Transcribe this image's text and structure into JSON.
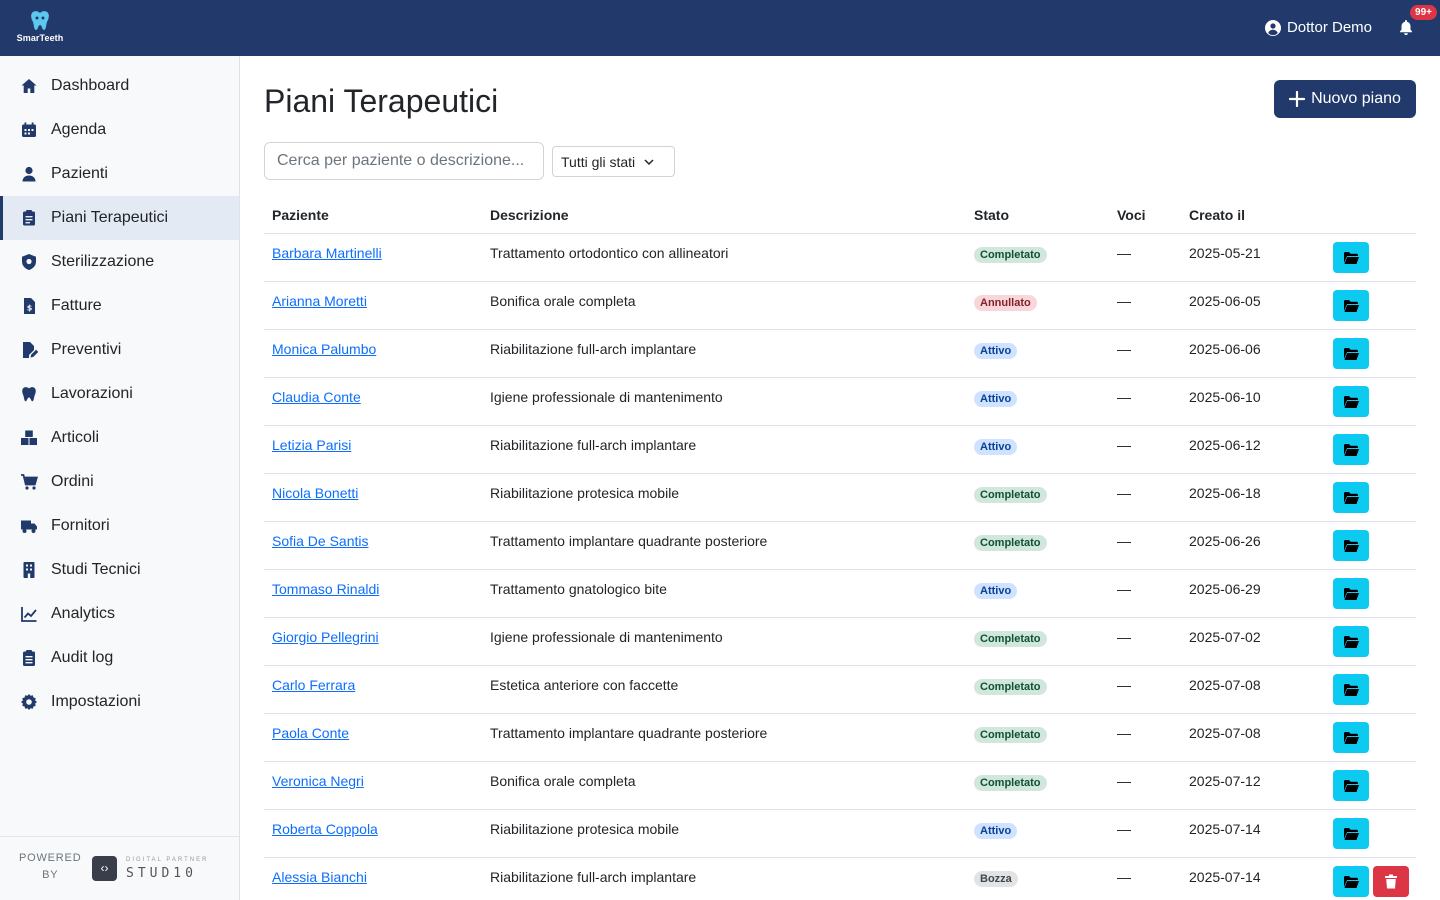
{
  "app": {
    "logo_text": "SmarTeeth",
    "user_name": "Dottor Demo",
    "notifications_badge": "99+",
    "brand_color": "#213a6b"
  },
  "sidebar": {
    "items": [
      {
        "label": "Dashboard",
        "icon": "home-icon"
      },
      {
        "label": "Agenda",
        "icon": "calendar-icon"
      },
      {
        "label": "Pazienti",
        "icon": "user-icon"
      },
      {
        "label": "Piani Terapeutici",
        "icon": "clipboard-icon",
        "active": true
      },
      {
        "label": "Sterilizzazione",
        "icon": "shield-icon"
      },
      {
        "label": "Fatture",
        "icon": "invoice-icon"
      },
      {
        "label": "Preventivi",
        "icon": "file-edit-icon"
      },
      {
        "label": "Lavorazioni",
        "icon": "tooth-icon"
      },
      {
        "label": "Articoli",
        "icon": "boxes-icon"
      },
      {
        "label": "Ordini",
        "icon": "cart-icon"
      },
      {
        "label": "Fornitori",
        "icon": "truck-icon"
      },
      {
        "label": "Studi Tecnici",
        "icon": "building-icon"
      },
      {
        "label": "Analytics",
        "icon": "chart-line-icon"
      },
      {
        "label": "Audit log",
        "icon": "clipboard-list-icon"
      },
      {
        "label": "Impostazioni",
        "icon": "gear-icon"
      }
    ],
    "footer": {
      "powered_line1": "POWERED",
      "powered_line2": "BY",
      "partner_small": "DIGITAL PARTNER",
      "partner_name": "STUD10"
    }
  },
  "main": {
    "title": "Piani Terapeutici",
    "new_button": "Nuovo piano",
    "search_placeholder": "Cerca per paziente o descrizione...",
    "status_filter": "Tutti gli stati",
    "columns": [
      "Paziente",
      "Descrizione",
      "Stato",
      "Voci",
      "Creato il"
    ],
    "rows": [
      {
        "patient": "Barbara Martinelli",
        "description": "Trattamento ortodontico con allineatori",
        "status": "Completato",
        "status_key": "completato",
        "items": "—",
        "created": "2025-05-21"
      },
      {
        "patient": "Arianna Moretti",
        "description": "Bonifica orale completa",
        "status": "Annullato",
        "status_key": "annullato",
        "items": "—",
        "created": "2025-06-05"
      },
      {
        "patient": "Monica Palumbo",
        "description": "Riabilitazione full-arch implantare",
        "status": "Attivo",
        "status_key": "attivo",
        "items": "—",
        "created": "2025-06-06"
      },
      {
        "patient": "Claudia Conte",
        "description": "Igiene professionale di mantenimento",
        "status": "Attivo",
        "status_key": "attivo",
        "items": "—",
        "created": "2025-06-10"
      },
      {
        "patient": "Letizia Parisi",
        "description": "Riabilitazione full-arch implantare",
        "status": "Attivo",
        "status_key": "attivo",
        "items": "—",
        "created": "2025-06-12"
      },
      {
        "patient": "Nicola Bonetti",
        "description": "Riabilitazione protesica mobile",
        "status": "Completato",
        "status_key": "completato",
        "items": "—",
        "created": "2025-06-18"
      },
      {
        "patient": "Sofia De Santis",
        "description": "Trattamento implantare quadrante posteriore",
        "status": "Completato",
        "status_key": "completato",
        "items": "—",
        "created": "2025-06-26"
      },
      {
        "patient": "Tommaso Rinaldi",
        "description": "Trattamento gnatologico bite",
        "status": "Attivo",
        "status_key": "attivo",
        "items": "—",
        "created": "2025-06-29"
      },
      {
        "patient": "Giorgio Pellegrini",
        "description": "Igiene professionale di mantenimento",
        "status": "Completato",
        "status_key": "completato",
        "items": "—",
        "created": "2025-07-02"
      },
      {
        "patient": "Carlo Ferrara",
        "description": "Estetica anteriore con faccette",
        "status": "Completato",
        "status_key": "completato",
        "items": "—",
        "created": "2025-07-08"
      },
      {
        "patient": "Paola Conte",
        "description": "Trattamento implantare quadrante posteriore",
        "status": "Completato",
        "status_key": "completato",
        "items": "—",
        "created": "2025-07-08"
      },
      {
        "patient": "Veronica Negri",
        "description": "Bonifica orale completa",
        "status": "Completato",
        "status_key": "completato",
        "items": "—",
        "created": "2025-07-12"
      },
      {
        "patient": "Roberta Coppola",
        "description": "Riabilitazione protesica mobile",
        "status": "Attivo",
        "status_key": "attivo",
        "items": "—",
        "created": "2025-07-14"
      },
      {
        "patient": "Alessia Bianchi",
        "description": "Riabilitazione full-arch implantare",
        "status": "Bozza",
        "status_key": "bozza",
        "items": "—",
        "created": "2025-07-14",
        "deletable": true
      }
    ]
  }
}
